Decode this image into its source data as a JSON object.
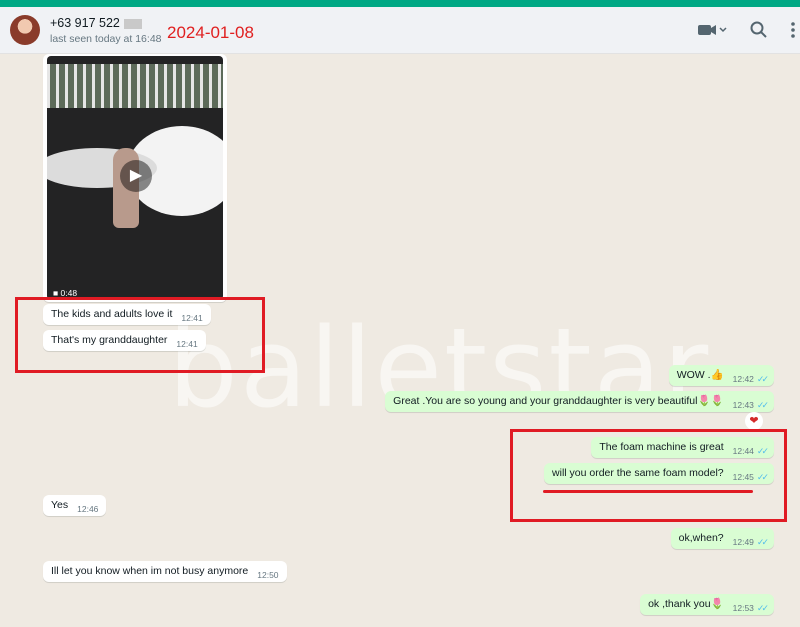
{
  "header": {
    "contact_name": "+63 917 522",
    "last_seen": "last seen today at 16:48",
    "annotation_date": "2024-01-08",
    "icons": [
      "video-call-icon",
      "chevron-down-icon",
      "search-icon",
      "menu-icon"
    ]
  },
  "watermark": "balletstar",
  "video": {
    "duration": "0:48",
    "icon": "play-icon"
  },
  "messages": [
    {
      "text": "The kids and adults love it",
      "time": "12:41",
      "direction": "in"
    },
    {
      "text": "That's my granddaughter",
      "time": "12:41",
      "direction": "in"
    },
    {
      "text": "WOW .👍",
      "time": "12:42",
      "direction": "out"
    },
    {
      "text": "Great .You are so young and your granddaughter is very beautiful🌷🌷",
      "time": "12:43",
      "direction": "out"
    },
    {
      "text": "The foam machine is great",
      "time": "12:44",
      "direction": "out"
    },
    {
      "text": "will you order the same foam model?",
      "time": "12:45",
      "direction": "out"
    },
    {
      "text": "Yes",
      "time": "12:46",
      "direction": "in"
    },
    {
      "text": "ok,when?",
      "time": "12:49",
      "direction": "out"
    },
    {
      "text": "Ill let you know when im not busy anymore",
      "time": "12:50",
      "direction": "in"
    },
    {
      "text": "ok ,thank you🌷",
      "time": "12:53",
      "direction": "out"
    }
  ],
  "reaction": "❤",
  "colors": {
    "accent": "#00a884",
    "incoming": "#ffffff",
    "outgoing": "#d9fdd3",
    "highlight": "#e01b24",
    "read_ticks": "#53bdeb"
  }
}
